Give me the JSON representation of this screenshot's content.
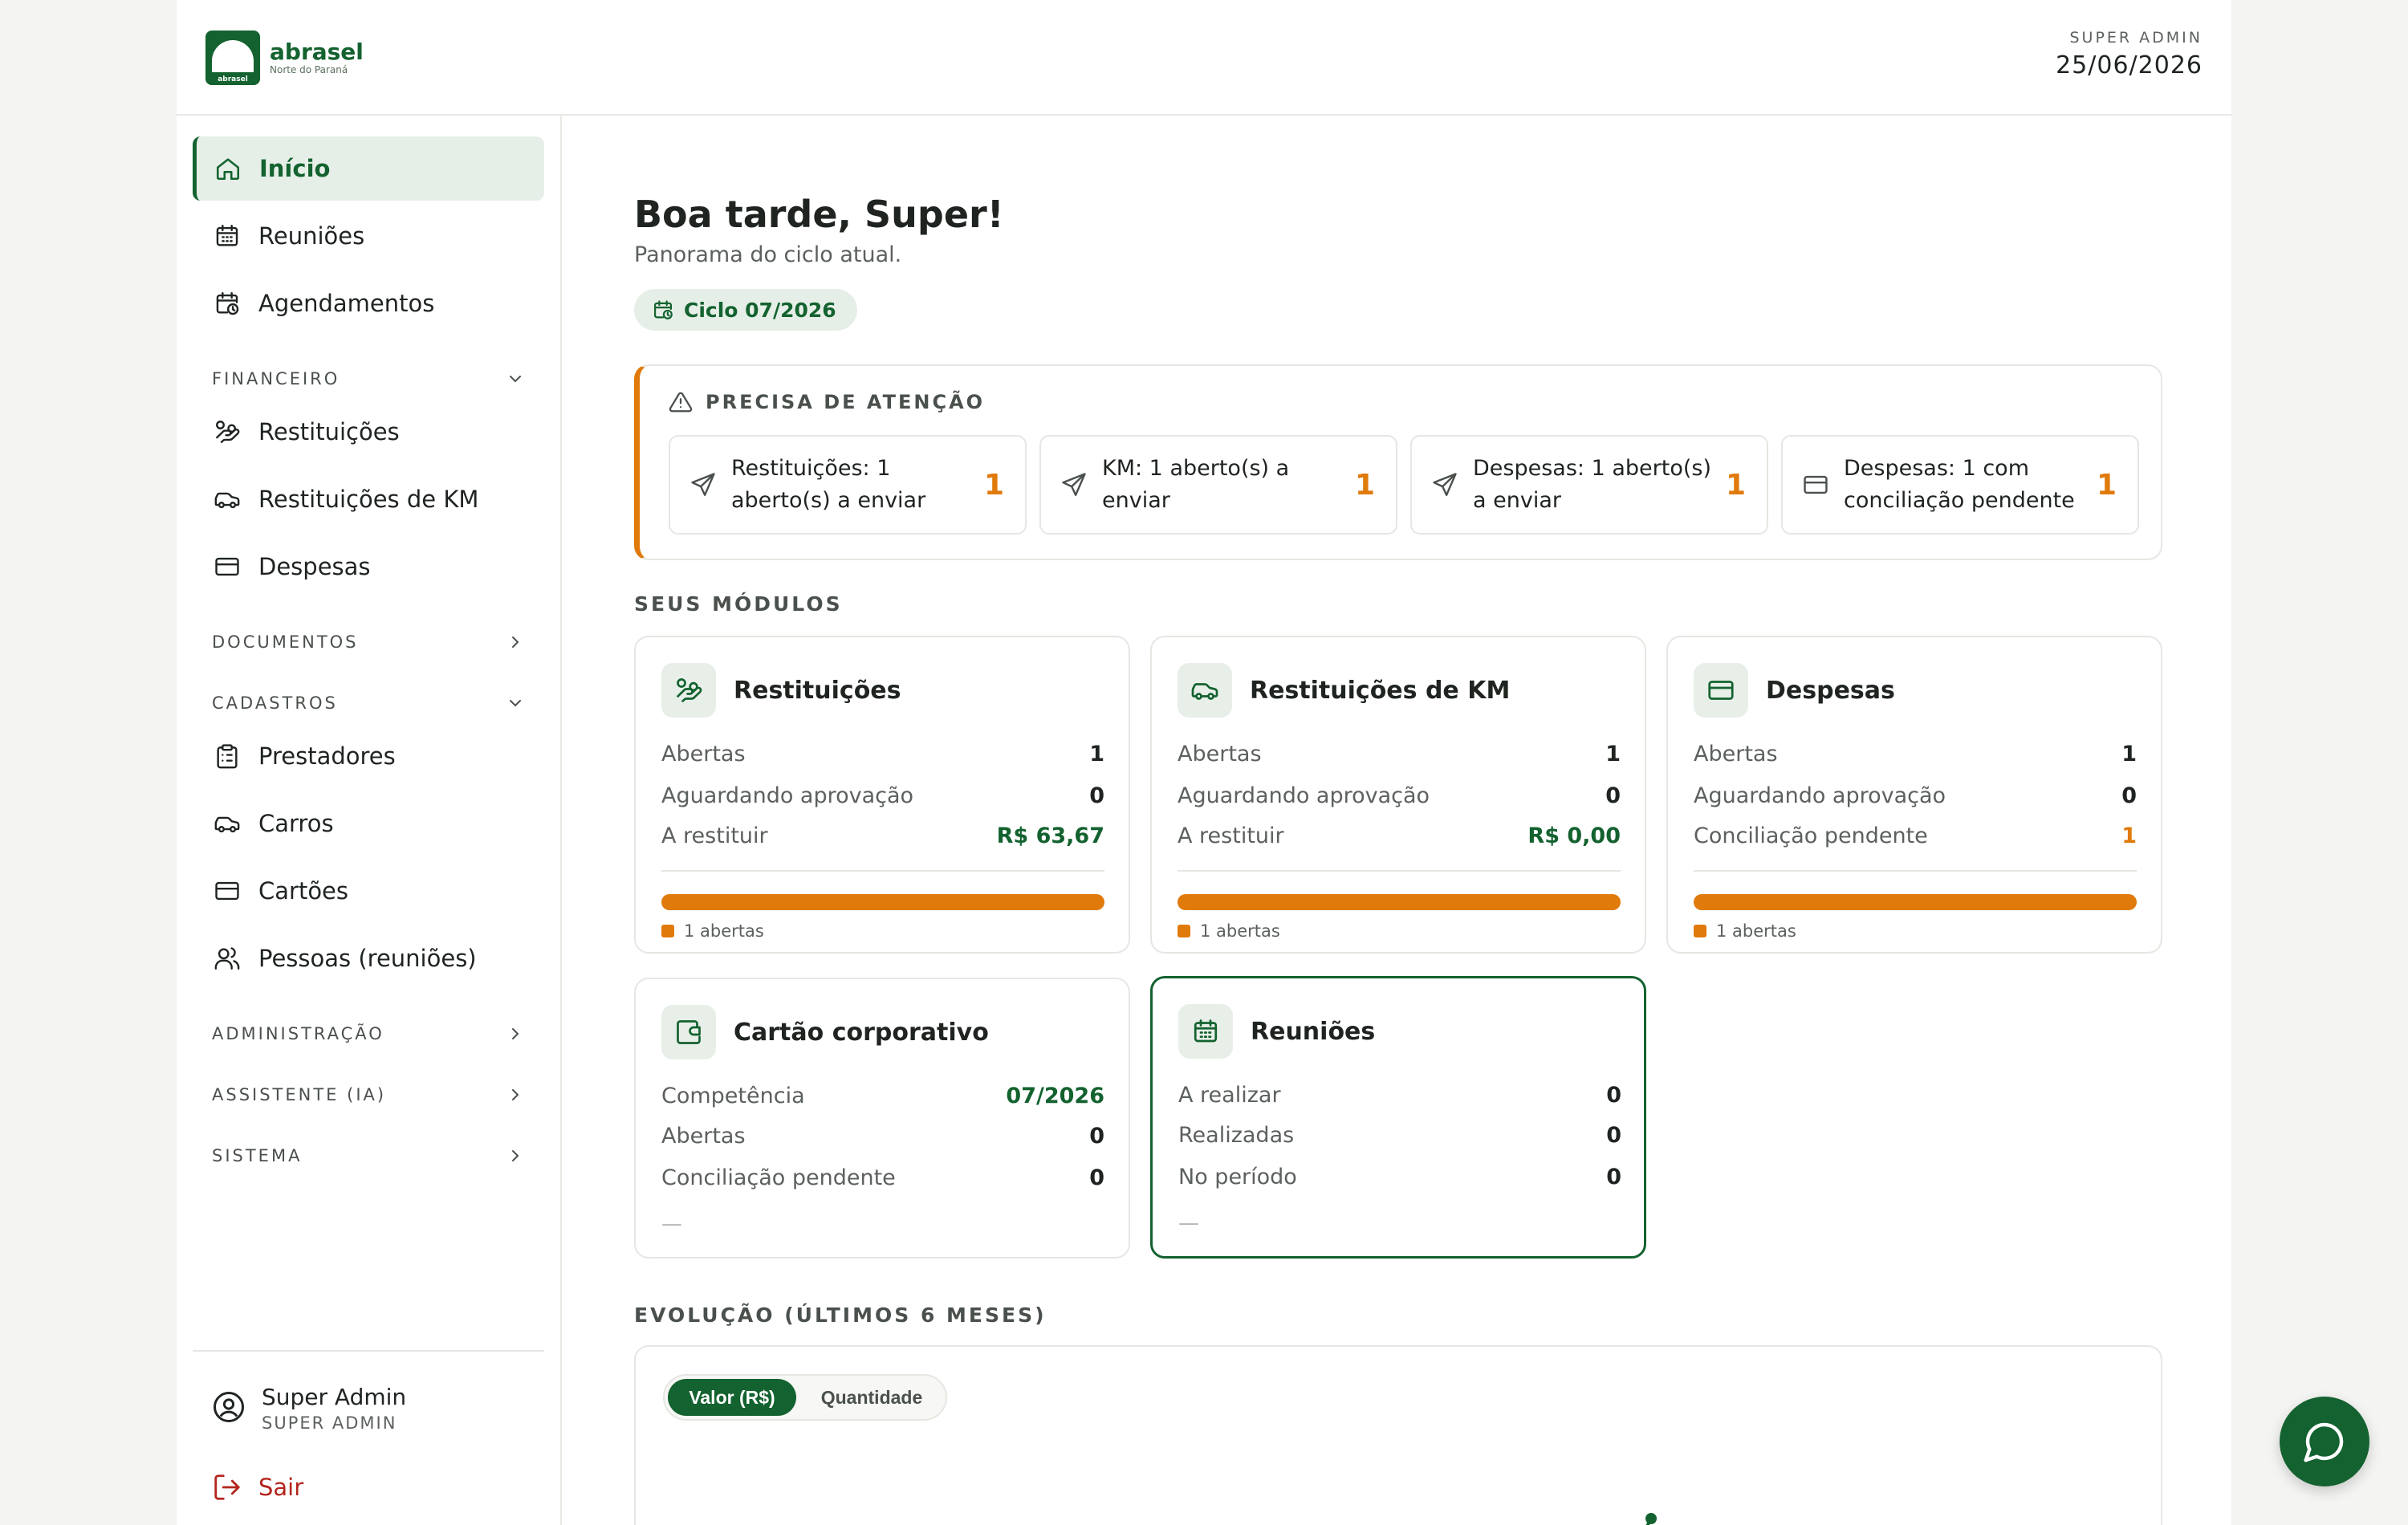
{
  "brand": {
    "mark_text": "abrasel",
    "name": "abrasel",
    "subtitle": "Norte do Paraná"
  },
  "header": {
    "role": "SUPER ADMIN",
    "date": "25/06/2026"
  },
  "sidebar": {
    "items_top": [
      {
        "label": "Início",
        "icon": "home-icon",
        "active": true
      },
      {
        "label": "Reuniões",
        "icon": "calendar-icon"
      },
      {
        "label": "Agendamentos",
        "icon": "calendar-clock-icon"
      }
    ],
    "sections": {
      "financeiro": "FINANCEIRO",
      "documentos": "DOCUMENTOS",
      "cadastros": "CADASTROS",
      "administracao": "ADMINISTRAÇÃO",
      "assistente": "ASSISTENTE (IA)",
      "sistema": "SISTEMA"
    },
    "financeiro_items": [
      {
        "label": "Restituições",
        "icon": "hand-coins-icon"
      },
      {
        "label": "Restituições de KM",
        "icon": "car-icon"
      },
      {
        "label": "Despesas",
        "icon": "credit-card-icon"
      }
    ],
    "cadastros_items": [
      {
        "label": "Prestadores",
        "icon": "clipboard-icon"
      },
      {
        "label": "Carros",
        "icon": "car-icon"
      },
      {
        "label": "Cartões",
        "icon": "credit-card-icon"
      },
      {
        "label": "Pessoas (reuniões)",
        "icon": "users-icon"
      }
    ],
    "user": {
      "name": "Super Admin",
      "role": "SUPER ADMIN"
    },
    "logout": "Sair"
  },
  "main": {
    "greeting": "Boa tarde, Super!",
    "subtitle": "Panorama do ciclo atual.",
    "cycle": "Ciclo 07/2026",
    "attention": {
      "title": "PRECISA DE ATENÇÃO",
      "cards": [
        {
          "label": "Restituições: 1 aberto(s) a enviar",
          "count": "1",
          "icon": "send-icon"
        },
        {
          "label": "KM: 1 aberto(s) a enviar",
          "count": "1",
          "icon": "send-icon"
        },
        {
          "label": "Despesas: 1 aberto(s) a enviar",
          "count": "1",
          "icon": "send-icon"
        },
        {
          "label": "Despesas: 1 com conciliação pendente",
          "count": "1",
          "icon": "credit-card-icon"
        }
      ]
    },
    "modules_title": "SEUS MÓDULOS",
    "modules": [
      {
        "title": "Restituições",
        "icon": "hand-coins-icon",
        "rows": [
          [
            "Abertas",
            "1"
          ],
          [
            "Aguardando aprovação",
            "0"
          ],
          [
            "A restituir",
            "R$ 63,67"
          ]
        ],
        "legend": "1 abertas",
        "open_fraction": 1.0
      },
      {
        "title": "Restituições de KM",
        "icon": "car-icon",
        "rows": [
          [
            "Abertas",
            "1"
          ],
          [
            "Aguardando aprovação",
            "0"
          ],
          [
            "A restituir",
            "R$ 0,00"
          ]
        ],
        "legend": "1 abertas",
        "open_fraction": 1.0
      },
      {
        "title": "Despesas",
        "icon": "credit-card-icon",
        "rows": [
          [
            "Abertas",
            "1"
          ],
          [
            "Aguardando aprovação",
            "0"
          ],
          [
            "Conciliação pendente",
            "1"
          ]
        ],
        "legend": "1 abertas",
        "open_fraction": 1.0
      },
      {
        "title": "Cartão corporativo",
        "icon": "wallet-icon",
        "rows": [
          [
            "Competência",
            "07/2026"
          ],
          [
            "Abertas",
            "0"
          ],
          [
            "Conciliação pendente",
            "0"
          ]
        ],
        "dash": "—"
      },
      {
        "title": "Reuniões",
        "icon": "calendar-icon",
        "rows": [
          [
            "A realizar",
            "0"
          ],
          [
            "Realizadas",
            "0"
          ],
          [
            "No período",
            "0"
          ]
        ],
        "dash": "—"
      }
    ],
    "evolution_title": "EVOLUÇÃO (ÚLTIMOS 6 MESES)",
    "toggle": {
      "value": "Valor (R$)",
      "quantity": "Quantidade"
    }
  },
  "colors": {
    "brand_green": "#13622f",
    "accent_orange": "#e07a0b",
    "danger": "#b3261e"
  }
}
